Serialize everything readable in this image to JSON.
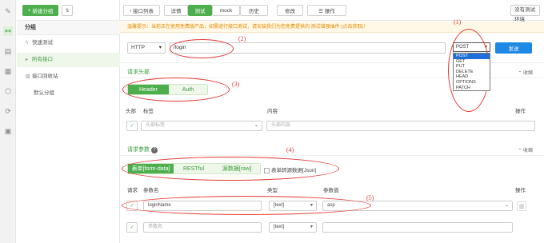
{
  "rail": {
    "icons": [
      "code-icon",
      "link-icon",
      "layers-icon",
      "calendar-icon",
      "box-icon",
      "share-icon",
      "chart-icon"
    ]
  },
  "sidebar": {
    "new_group": "新建分组",
    "title": "分组",
    "items": [
      {
        "label": "快速测试",
        "icon": "⚲"
      },
      {
        "label": "所有接口",
        "icon": "▸"
      },
      {
        "label": "接口回收站",
        "icon": "🗑"
      },
      {
        "label": "默认分组",
        "icon": ""
      }
    ]
  },
  "toolbar": {
    "back": "接口列表",
    "detail": "详情",
    "test": "测试",
    "mock": "mock",
    "history": "历史",
    "edit": "修改",
    "ops": "☰ 操作",
    "env": "没有测试环境"
  },
  "notice": "温馨提示：当前正在使用免费版产品，如需进行接口测试，请安装我们为您免费提供的 测试增强插件 (点击获取)！",
  "request": {
    "protocol": "HTTP",
    "url": "/login",
    "method": "POST",
    "send": "发送",
    "methods": [
      "POST",
      "GET",
      "PUT",
      "DELETE",
      "HEAD",
      "OPTIONS",
      "PATCH"
    ]
  },
  "headers_section": {
    "title": "请求头部",
    "collapse": "收缩",
    "tabs": [
      "Header",
      "Auth"
    ],
    "columns": {
      "h": "头部",
      "label": "标签",
      "content": "内容",
      "op": "操作"
    },
    "row": {
      "label_placeholder": "头部标签",
      "content_placeholder": "头部内容"
    }
  },
  "params_section": {
    "title": "请求参数",
    "collapse": "收缩",
    "tabs": [
      "表单[form-data]",
      "RESTful",
      "源数据[raw]"
    ],
    "json_toggle": "表单转源数据[Json]",
    "columns": {
      "req": "请求",
      "name": "参数名",
      "type": "类型",
      "value": "参数值",
      "op": "操作"
    },
    "rows": [
      {
        "name": "loginName",
        "type": "[text]",
        "value": "asp"
      },
      {
        "name": "参数名",
        "type": "[text]",
        "value": ""
      }
    ]
  },
  "annotations": [
    "(1)",
    "(2)",
    "(3)",
    "(4)",
    "(5)"
  ]
}
